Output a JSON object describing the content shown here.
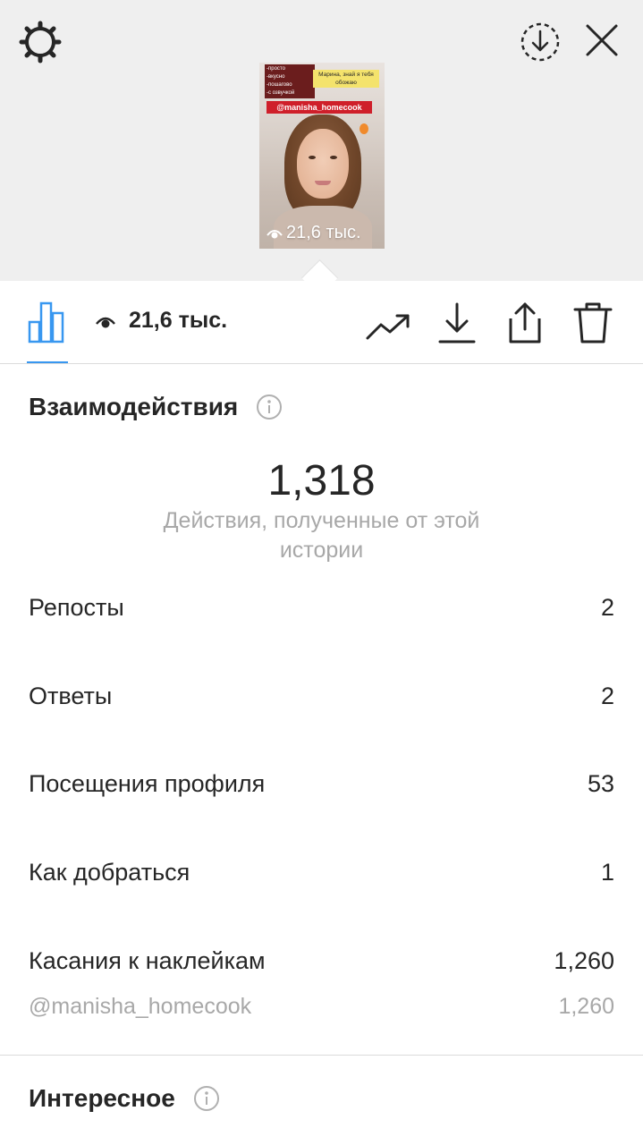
{
  "story_preview": {
    "sticker_lines": [
      "-просто",
      "-вкусно",
      "-пошагово",
      "-с озвучкой"
    ],
    "sticker_note": "Марина, знай я тебя обожаю",
    "mention": "@manisha_homecook",
    "views": "21,6 тыс."
  },
  "toolbar": {
    "views": "21,6 тыс."
  },
  "interactions": {
    "title": "Взаимодействия",
    "total": "1,318",
    "caption": "Действия, полученные от этой истории",
    "rows": [
      {
        "label": "Репосты",
        "value": "2"
      },
      {
        "label": "Ответы",
        "value": "2"
      },
      {
        "label": "Посещения профиля",
        "value": "53"
      },
      {
        "label": "Как добраться",
        "value": "1"
      },
      {
        "label": "Касания к наклейкам",
        "value": "1,260"
      }
    ],
    "sticker_detail": {
      "label": "@manisha_homecook",
      "value": "1,260"
    }
  },
  "discovery": {
    "title": "Интересное"
  },
  "colors": {
    "accent": "#3897f0",
    "text": "#262626",
    "muted": "#a8a8a8",
    "header_bg": "#efefef"
  },
  "icons": {
    "settings": "gear-icon",
    "save": "download-circle-icon",
    "close": "close-icon",
    "stats": "bar-chart-icon",
    "views": "eye-icon",
    "promote": "trending-up-icon",
    "download": "download-icon",
    "share": "share-icon",
    "delete": "trash-icon",
    "info": "info-icon"
  }
}
